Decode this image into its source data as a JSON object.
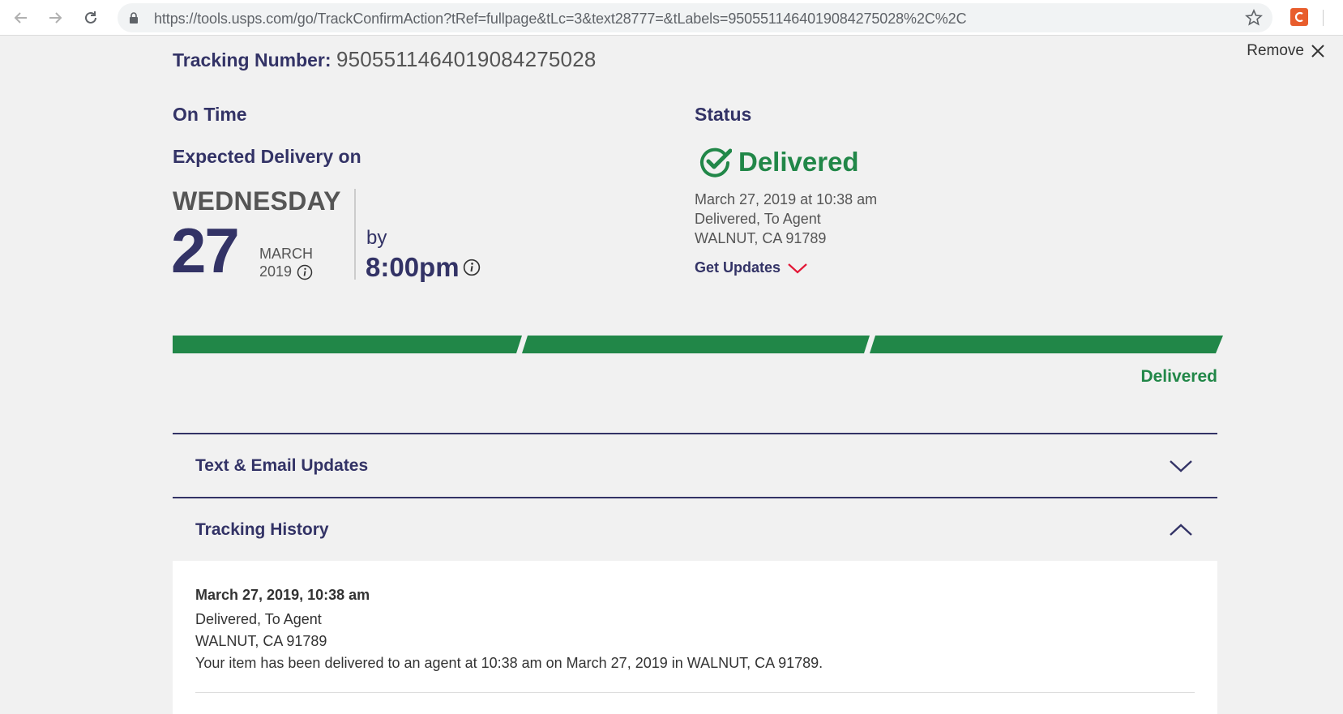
{
  "browser": {
    "url": "https://tools.usps.com/go/TrackConfirmAction?tRef=fullpage&tLc=3&text28777=&tLabels=9505511464019084275028%2C%2C"
  },
  "remove": {
    "label": "Remove"
  },
  "tracking": {
    "label": "Tracking Number:",
    "number": "9505511464019084275028"
  },
  "expected": {
    "on_time": "On Time",
    "heading": "Expected Delivery on",
    "weekday": "WEDNESDAY",
    "day": "27",
    "month": "MARCH",
    "year": "2019",
    "by": "by",
    "time": "8:00pm"
  },
  "status": {
    "heading": "Status",
    "state": "Delivered",
    "datetime": "March 27, 2019 at 10:38 am",
    "detail": "Delivered, To Agent",
    "location": "WALNUT, CA 91789",
    "get_updates": "Get Updates"
  },
  "progress": {
    "segments_complete": 3,
    "segments_total": 3,
    "label": "Delivered",
    "color": "#218748"
  },
  "panels": {
    "text_email": "Text & Email Updates",
    "history": "Tracking History"
  },
  "history": {
    "date": "March 27, 2019, 10:38 am",
    "event": "Delivered, To Agent",
    "location": "WALNUT, CA 91789",
    "message": "Your item has been delivered to an agent at 10:38 am on March 27, 2019 in WALNUT, CA 91789."
  },
  "colors": {
    "navy": "#333366",
    "green": "#218748",
    "red": "#e31837"
  }
}
